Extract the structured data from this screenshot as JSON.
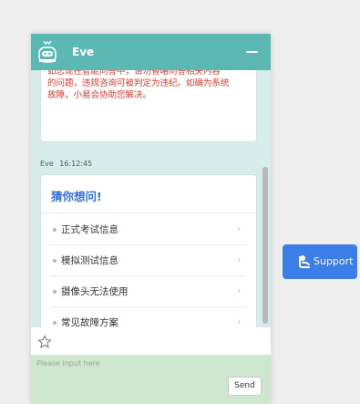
{
  "header": {
    "title": "Eve",
    "minimize_icon": "minus-icon",
    "avatar_icon": "robot-icon"
  },
  "notice": {
    "text": "如您现在智能问答中，请勿省略问答相关内容\n的问题，违规咨询可被判定为违纪。如确为系统\n故障，小易会协助您解决。"
  },
  "message": {
    "sender": "Eve",
    "time": "16:12:45"
  },
  "faq_card": {
    "title": "猜你想问!",
    "items": [
      {
        "label": "正式考试信息"
      },
      {
        "label": "模拟测试信息"
      },
      {
        "label": "摄像头无法使用"
      },
      {
        "label": "常见故障方案"
      }
    ],
    "chevron": "›"
  },
  "composer": {
    "placeholder": "Please input here",
    "value": "",
    "send_label": "Send",
    "star_icon": "star-icon"
  },
  "support": {
    "label": "Support",
    "icon": "person-headset-icon"
  },
  "colors": {
    "header": "#5cb8b2",
    "notice_text": "#e23a2b",
    "faq_title": "#2f6fe0",
    "support": "#3b7ee8",
    "composer": "#cfe7cf"
  }
}
